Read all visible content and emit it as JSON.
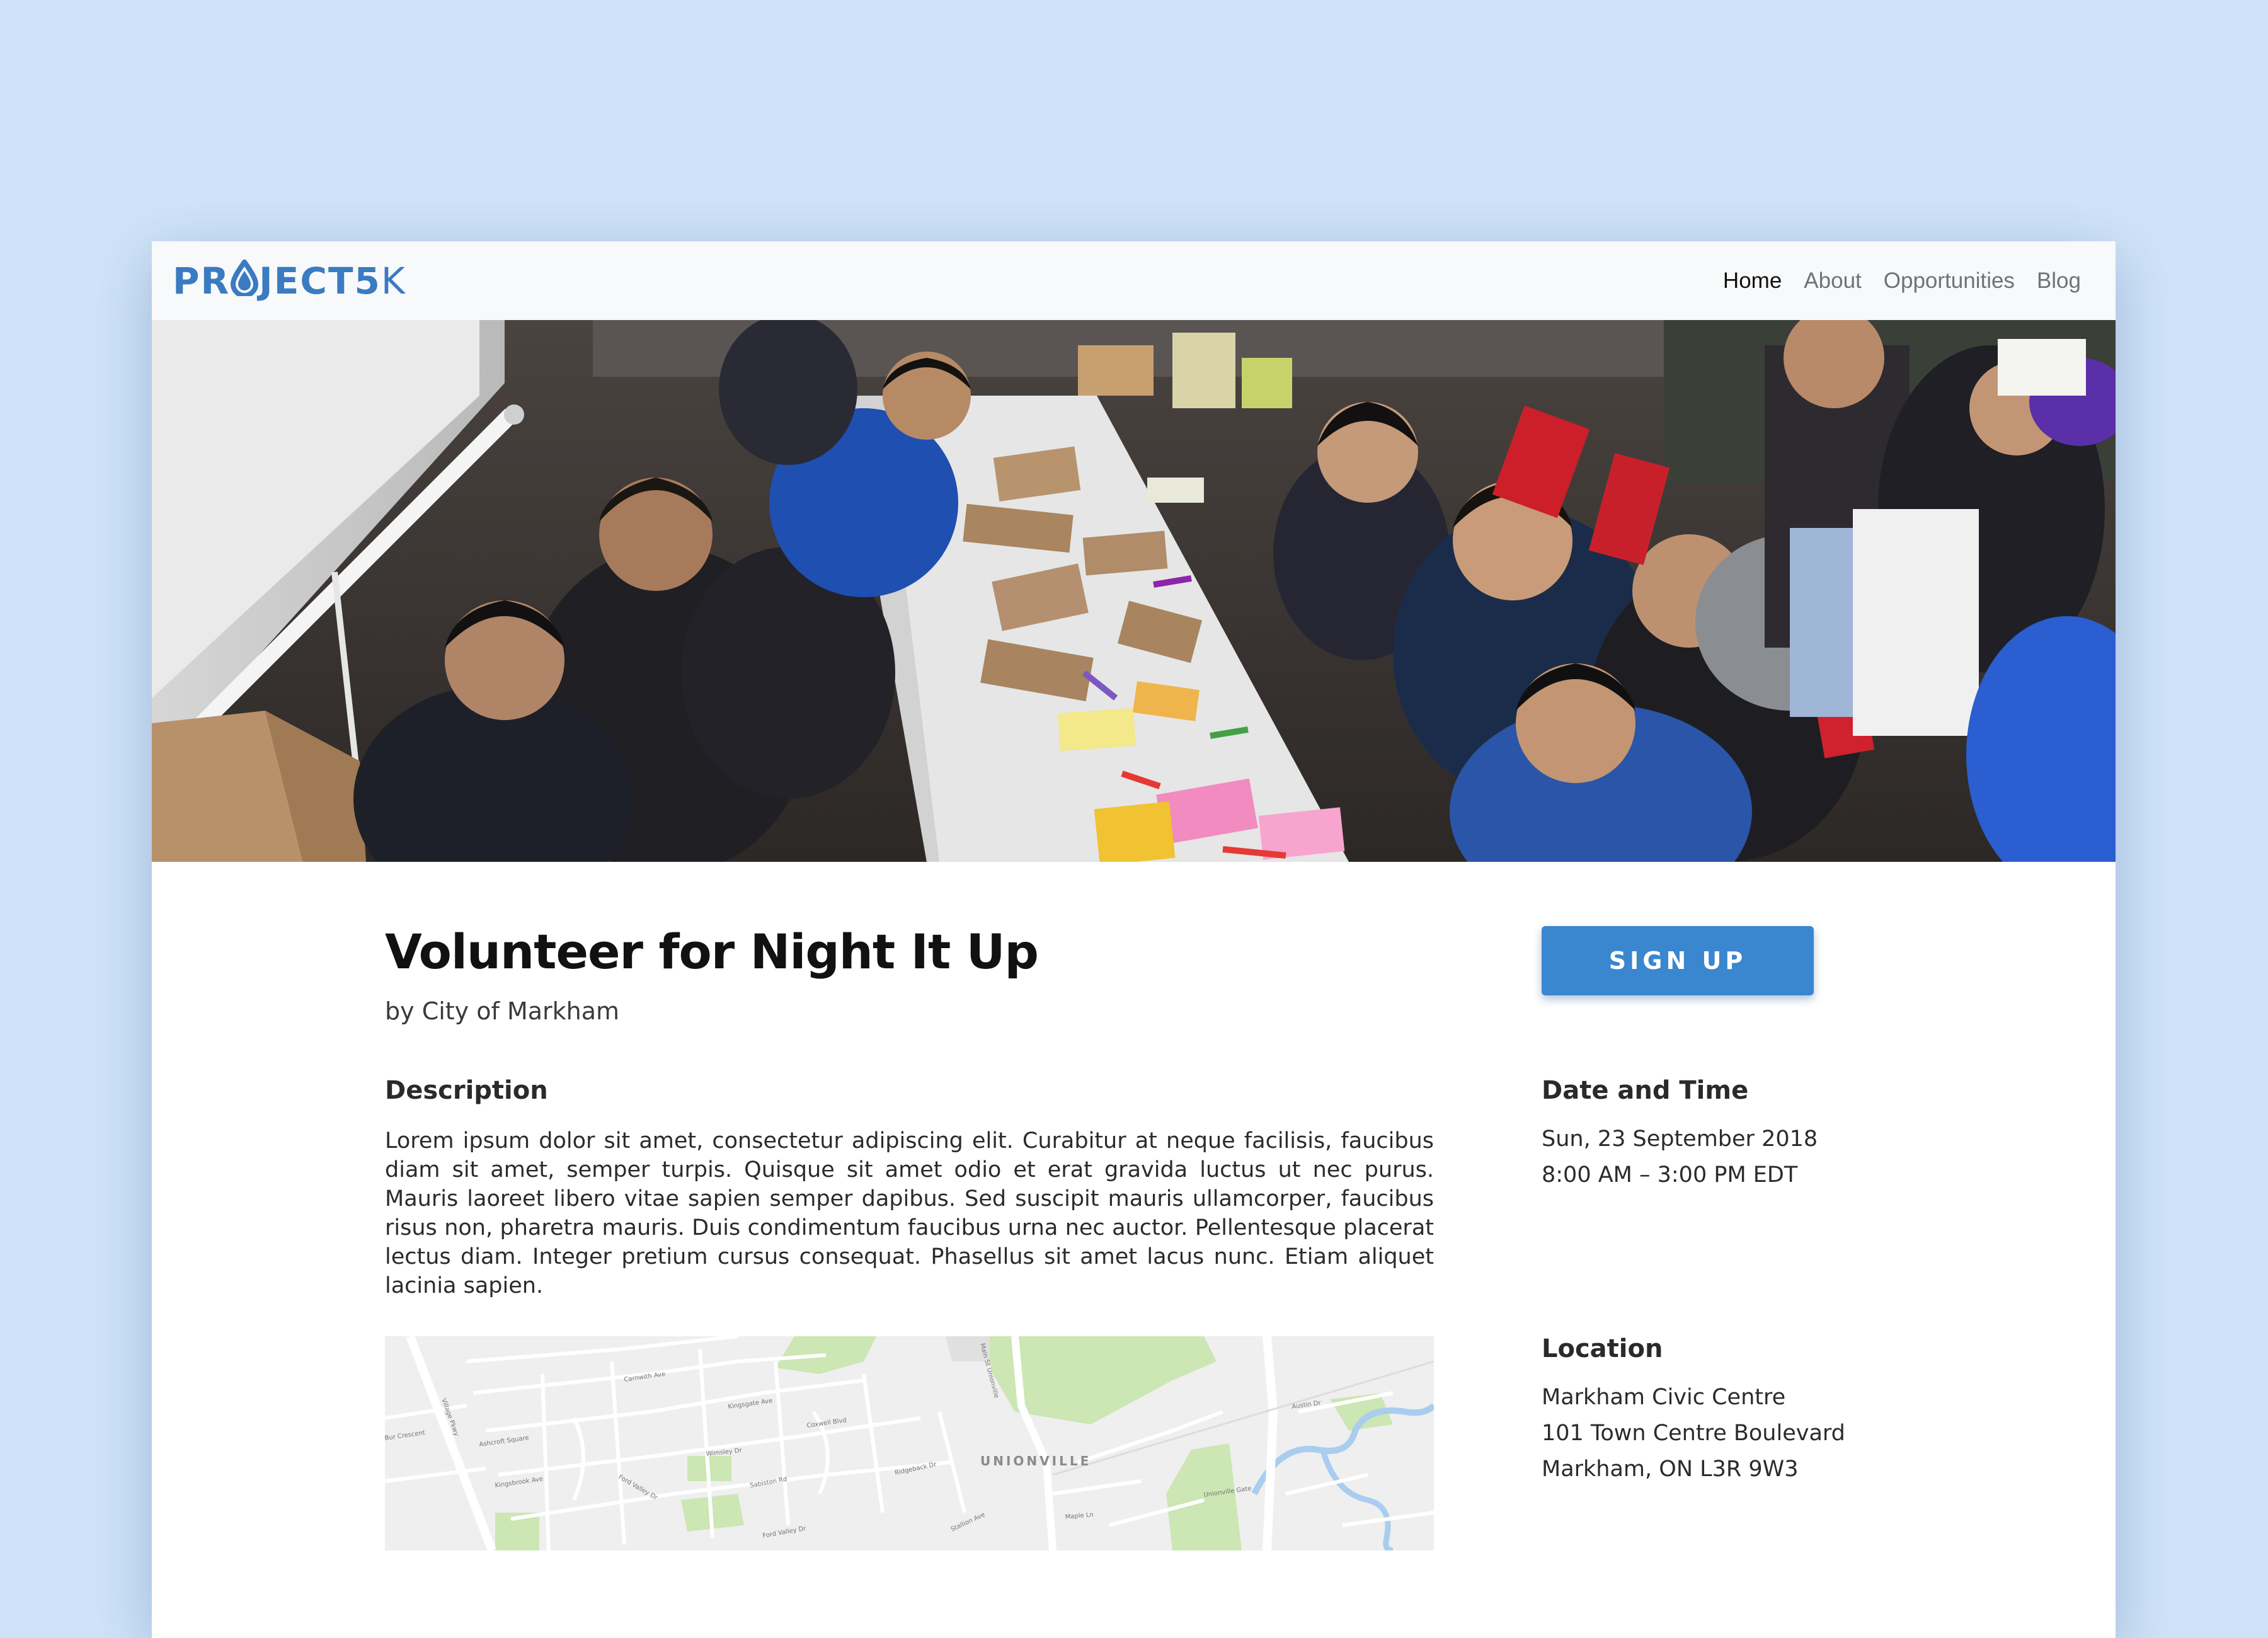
{
  "brand": {
    "logo_text": "PROJECT5K",
    "accent_color": "#3a7bc1"
  },
  "nav": {
    "items": [
      {
        "label": "Home",
        "active": true
      },
      {
        "label": "About",
        "active": false
      },
      {
        "label": "Opportunities",
        "active": false
      },
      {
        "label": "Blog",
        "active": false
      }
    ]
  },
  "hero": {
    "image": "volunteers-photo"
  },
  "event": {
    "title": "Volunteer for Night It Up",
    "byline": "by City of Markham",
    "signup_label": "SIGN UP",
    "signup_color": "#3a86cf"
  },
  "description": {
    "heading": "Description",
    "body": "Lorem ipsum dolor sit amet, consectetur adipiscing elit. Curabitur at neque facilisis, faucibus diam sit amet, semper turpis. Quisque sit amet odio et erat gravida luctus ut nec purus. Mauris laoreet libero vitae sapien semper dapibus. Sed suscipit mauris ullamcorper, faucibus risus non, pharetra mauris. Duis condimentum faucibus urna nec auctor. Pellentesque placerat lectus diam. Integer pretium cursus consequat. Phasellus sit amet lacus nunc. Etiam aliquet lacinia sapien."
  },
  "datetime": {
    "heading": "Date and Time",
    "date": "Sun, 23 September 2018",
    "time": "8:00 AM – 3:00 PM EDT"
  },
  "location": {
    "heading": "Location",
    "name": "Markham Civic Centre",
    "street": "101 Town Centre Boulevard",
    "city": "Markham, ON L3R 9W3"
  },
  "map": {
    "area_label": "UNIONVILLE",
    "street_labels": [
      "Carnwith Ave",
      "Kingsgate Ave",
      "Coxwell Blvd",
      "Wimsley Dr",
      "Ashcroft Square",
      "Kingsbrook Ave",
      "Ford Valley Dr",
      "Sabiston Rd",
      "Ridgeback Dr",
      "Village Pkwy",
      "Bur Crescent",
      "Main St Unionville",
      "Ford Valley Dr",
      "Stallion Ave",
      "Maple Ln",
      "Austin Dr",
      "Unionville Gate"
    ]
  }
}
